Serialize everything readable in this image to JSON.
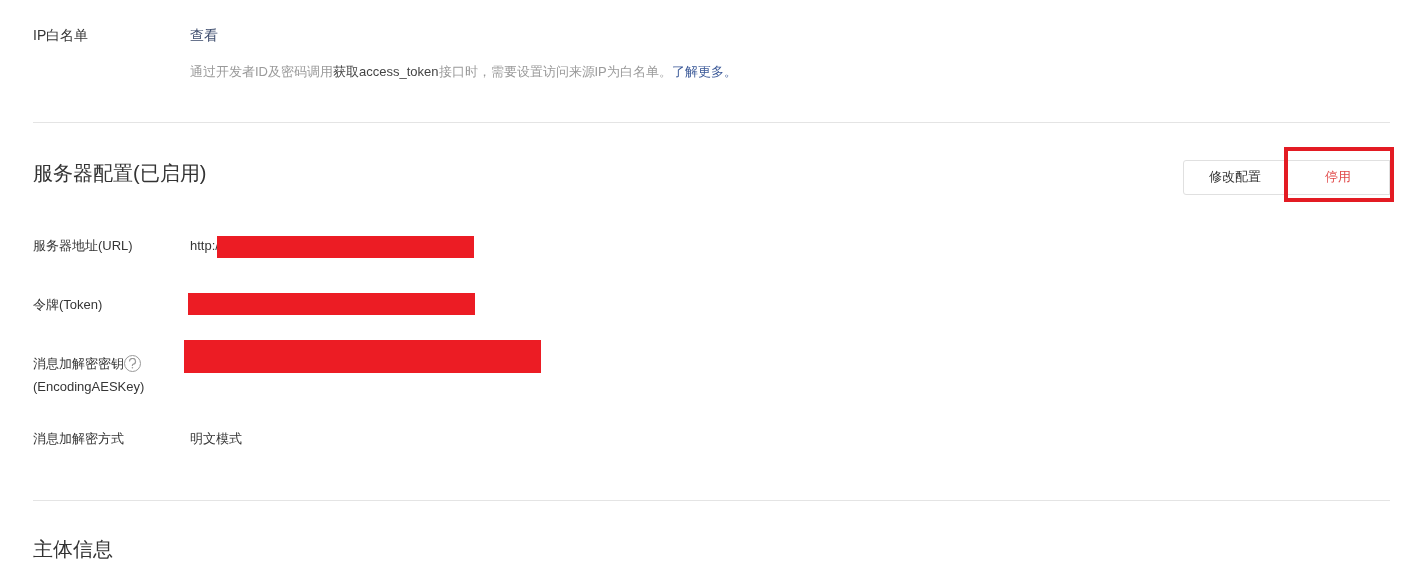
{
  "ip_whitelist": {
    "label": "IP白名单",
    "link": "查看",
    "description": [
      {
        "kind": "text",
        "text": "通过开发者ID及密码调用"
      },
      {
        "kind": "strong",
        "text": "获取access_token"
      },
      {
        "kind": "text",
        "text": "接口时，需要设置访问来源IP为白名单。"
      },
      {
        "kind": "link",
        "text": "了解更多。"
      }
    ]
  },
  "server_config": {
    "title": "服务器配置(已启用)",
    "buttons": [
      {
        "label": "修改配置",
        "kind": "default",
        "highlighted": false
      },
      {
        "label": "停用",
        "kind": "danger",
        "highlighted": true
      }
    ],
    "fields": [
      {
        "label": "服务器地址(URL)",
        "value": "http:/",
        "redacted": true
      },
      {
        "label": "令牌(Token)",
        "redacted": true
      },
      {
        "label": "消息加解密密钥",
        "help": true,
        "sublabel": "(EncodingAESKey)",
        "redacted": true
      },
      {
        "label": "消息加解密方式",
        "value": "明文模式"
      }
    ]
  },
  "next_section": {
    "title": "主体信息"
  }
}
